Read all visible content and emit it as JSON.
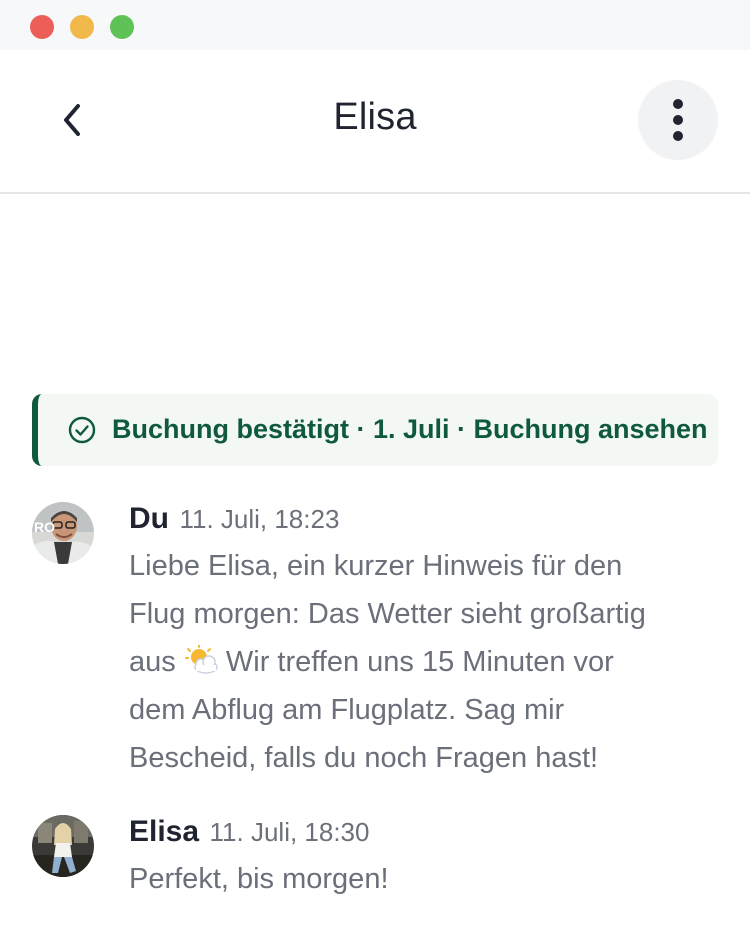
{
  "window": {
    "colors": {
      "close": "#ec5f58",
      "minimize": "#f1b84a",
      "zoom": "#5fc257"
    }
  },
  "header": {
    "title": "Elisa",
    "back_icon": "chevron-left-icon",
    "more_icon": "more-vertical-icon"
  },
  "banner": {
    "icon": "check-circle-icon",
    "text": "Buchung bestätigt · 1. Juli · Buchung ansehen",
    "accent_color": "#0f5a3c"
  },
  "messages": [
    {
      "author": "Du",
      "time": "11. Juli, 18:23",
      "lines": [
        "Liebe Elisa, ein kurzer Hinweis für den",
        "Flug morgen: Das Wetter sieht großartig",
        "aus",
        " Wir treffen uns 15 Minuten vor",
        "dem Abflug am Flugplatz. Sag mir",
        "Bescheid, falls du noch Fragen hast!"
      ],
      "emoji": "sun-behind-cloud-icon"
    },
    {
      "author": "Elisa",
      "time": "11. Juli, 18:30",
      "text": "Perfekt, bis morgen!"
    }
  ]
}
